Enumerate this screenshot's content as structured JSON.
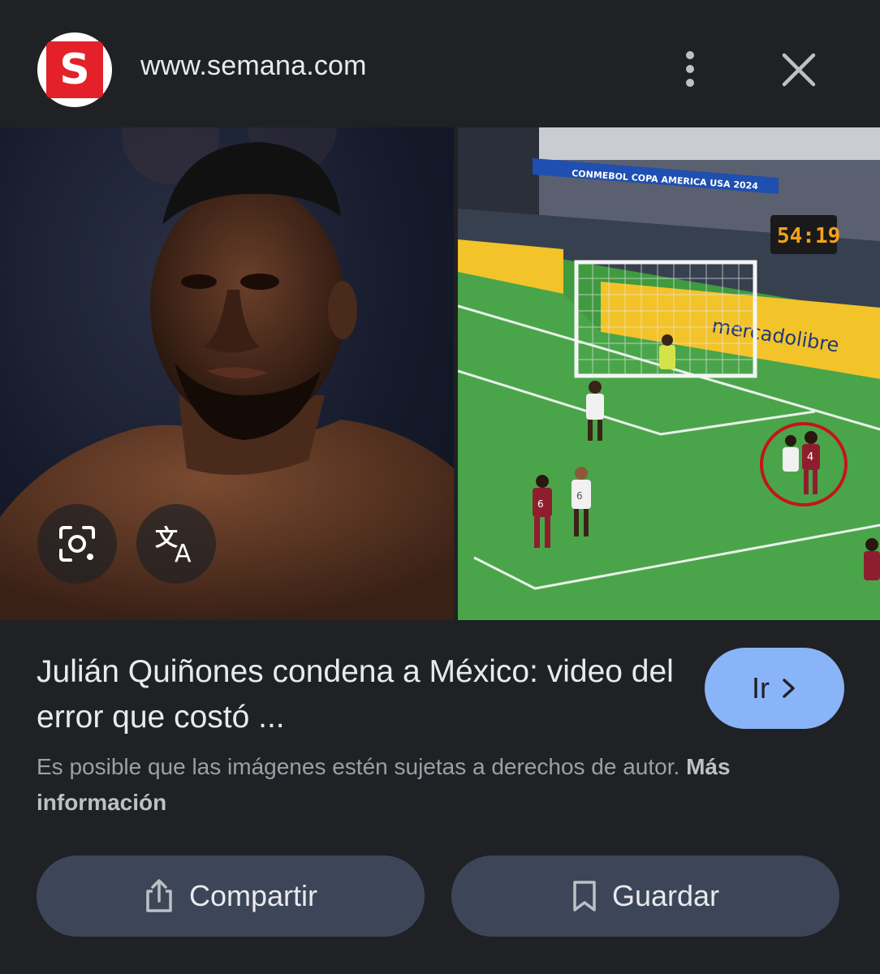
{
  "header": {
    "site_logo_letter": "S",
    "site_url": "www.semana.com",
    "more_icon": "more-vert-icon",
    "close_icon": "close-icon"
  },
  "images": {
    "left_image": "player-portrait",
    "right_image": "soccer-match-frame",
    "scoreboard_time": "54:19",
    "banner_text": "CONMEBOL COPA AMERICA USA 2024",
    "ad_text": "mercadolibre",
    "lens_icon": "lens-search-icon",
    "translate_icon": "translate-icon"
  },
  "result": {
    "title": "Julián Quiñones condena a México: video del error que costó ...",
    "go_label": "Ir",
    "copyright_text": "Es posible que las imágenes estén sujetas a derechos de autor.",
    "more_info_label": "Más información"
  },
  "actions": {
    "share_label": "Compartir",
    "save_label": "Guardar"
  },
  "colors": {
    "background": "#202124",
    "accent": "#8ab4f8",
    "button_bg": "#3c4658",
    "brand_red": "#e4202a"
  }
}
